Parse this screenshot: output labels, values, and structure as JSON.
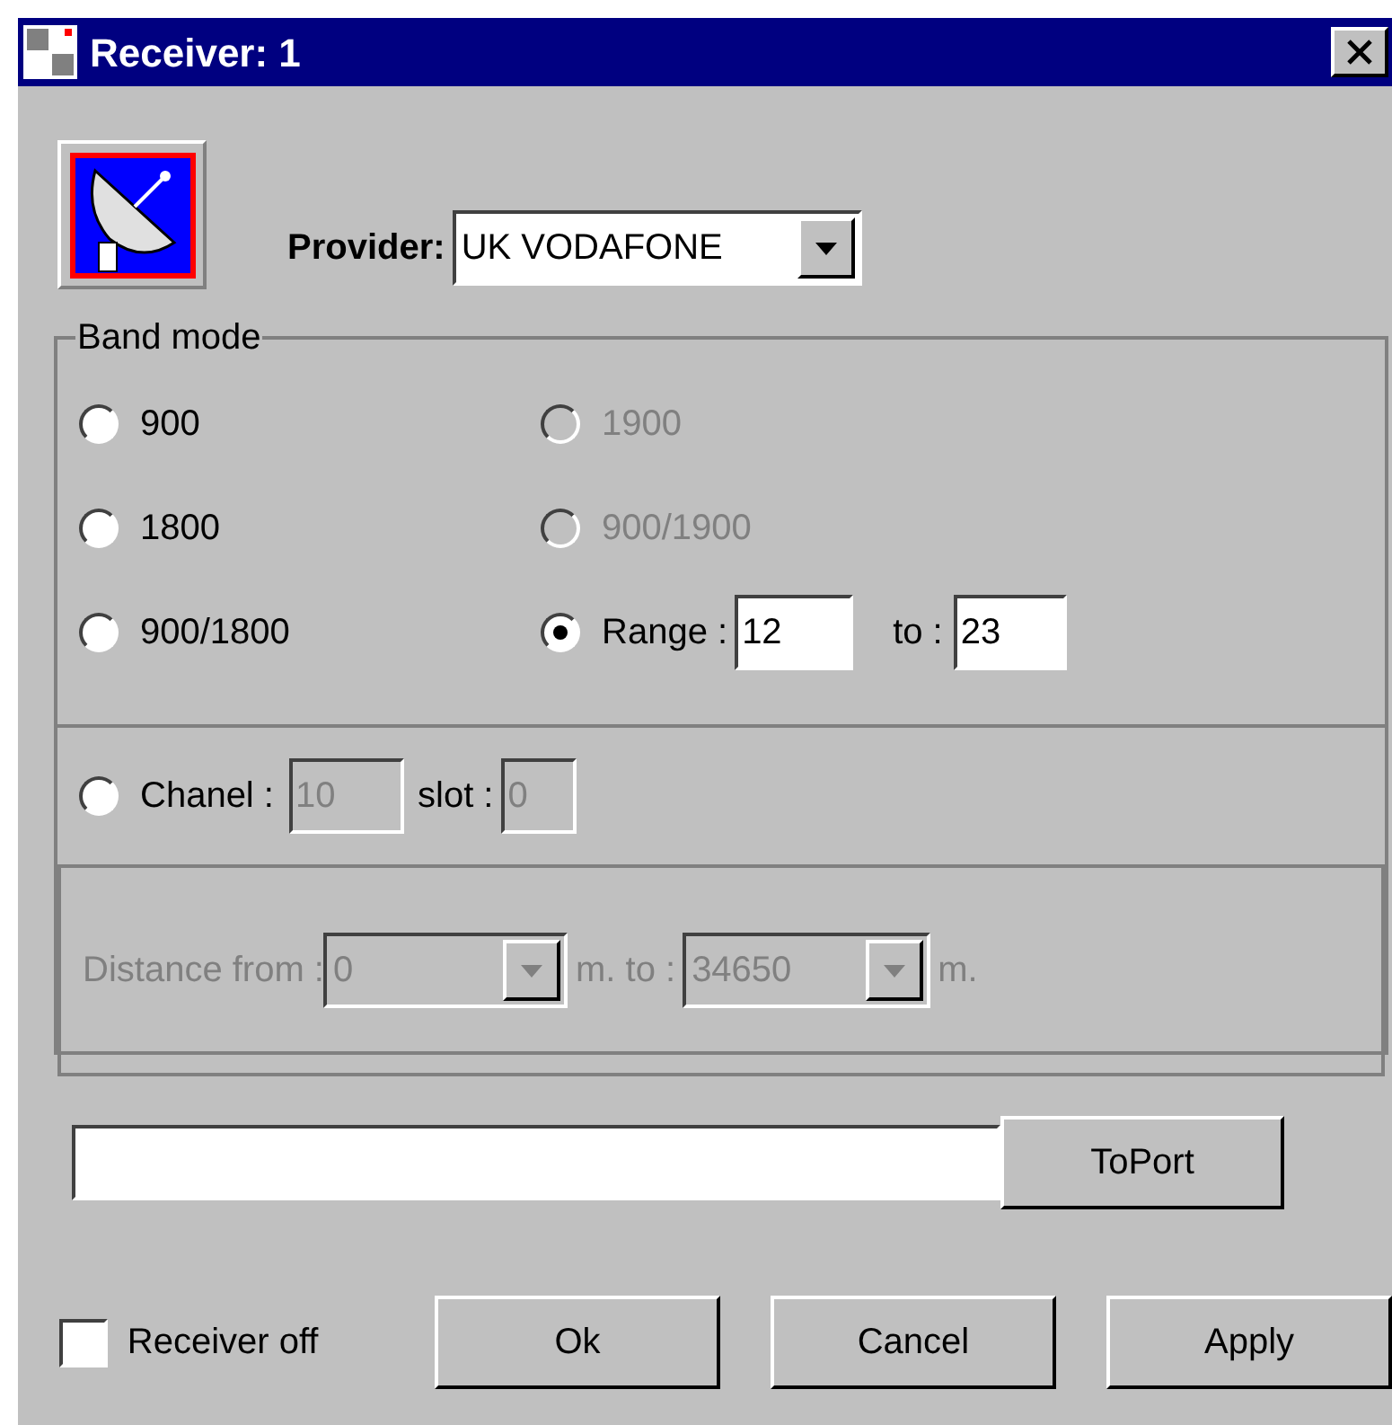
{
  "window": {
    "title": "Receiver: 1"
  },
  "provider": {
    "label": "Provider:",
    "value": "UK VODAFONE"
  },
  "band_mode": {
    "legend": "Band mode",
    "options": [
      {
        "kind": "plain",
        "label": "900",
        "selected": false,
        "disabled": false
      },
      {
        "kind": "plain",
        "label": "1900",
        "selected": false,
        "disabled": true
      },
      {
        "kind": "plain",
        "label": "1800",
        "selected": false,
        "disabled": false
      },
      {
        "kind": "plain",
        "label": "900/1900",
        "selected": false,
        "disabled": true
      },
      {
        "kind": "plain",
        "label": "900/1800",
        "selected": false,
        "disabled": false
      },
      {
        "kind": "range",
        "label": "Range :",
        "selected": true,
        "disabled": false,
        "from": "12",
        "to_label": "to :",
        "to": "23"
      }
    ],
    "channel": {
      "label": "Chanel :",
      "selected": false,
      "value": "10",
      "slot_label": "slot :",
      "slot_value": "0",
      "disabled": true
    },
    "distance": {
      "label": "Distance from :",
      "from": "0",
      "middle": "m. to :",
      "to": "34650",
      "unit": "m.",
      "disabled": true
    }
  },
  "port": {
    "button": "ToPort"
  },
  "receiver_off": {
    "label": "Receiver off",
    "checked": false
  },
  "buttons": [
    "Ok",
    "Cancel",
    "Apply"
  ]
}
